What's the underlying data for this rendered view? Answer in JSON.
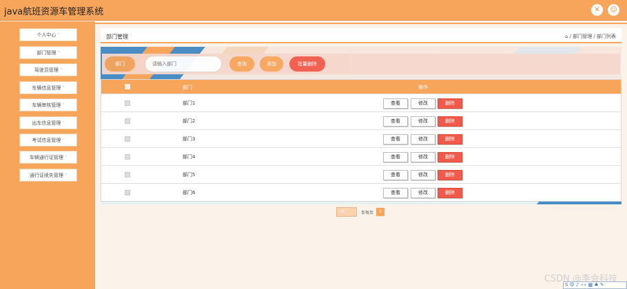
{
  "app": {
    "title": "java航班资源车管理系统"
  },
  "header_icons": [
    "fullscreen-icon",
    "user-icon"
  ],
  "sidebar": {
    "items": [
      {
        "label": "个人中心"
      },
      {
        "label": "部门管理"
      },
      {
        "label": "驾驶员管理"
      },
      {
        "label": "车辆信息管理"
      },
      {
        "label": "车辆审核管理"
      },
      {
        "label": "出车信息管理"
      },
      {
        "label": "考试信息管理"
      },
      {
        "label": "车辆通行证管理"
      },
      {
        "label": "通行证续失管理"
      }
    ],
    "chevron": "˅"
  },
  "panel": {
    "title": "部门管理",
    "breadcrumb": "⌂ / 部门管理 / 部门列表"
  },
  "toolbar": {
    "field_label": "部门",
    "search_placeholder": "请输入部门",
    "query_label": "查询",
    "add_label": "添加",
    "batch_delete_label": "批量删除"
  },
  "table": {
    "columns": [
      "部门",
      "操作"
    ],
    "rows": [
      {
        "name": "部门1"
      },
      {
        "name": "部门2"
      },
      {
        "name": "部门3"
      },
      {
        "name": "部门4"
      },
      {
        "name": "部门5"
      },
      {
        "name": "部门6"
      }
    ],
    "actions": {
      "view": "查看",
      "edit": "修改",
      "delete": "删除"
    }
  },
  "pagination": {
    "page_size": "10",
    "total_label": "条每页",
    "current_page": "1"
  },
  "watermark": "CSDN @李会科技",
  "ime_bar": "S 中 ♪ ∘∘ ▦ ♣ ✎",
  "colors": {
    "accent": "#f8a55c",
    "danger": "#f05a4a",
    "blue": "#2c7bbf"
  }
}
